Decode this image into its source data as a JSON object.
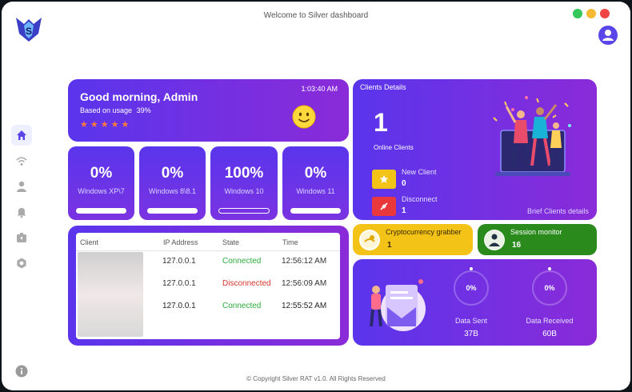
{
  "window": {
    "title": "Welcome to Silver dashboard",
    "traffic_colors": [
      "#34c759",
      "#f5b932",
      "#ef4444"
    ]
  },
  "greeting": {
    "title": "Good morning, Admin",
    "usage_label": "Based on usage",
    "usage_value": "39%",
    "rating": 5,
    "time": "1:03:40 AM"
  },
  "os_stats": [
    {
      "pct": "0%",
      "name": "Windows XP\\7"
    },
    {
      "pct": "0%",
      "name": "Windows 8\\8.1"
    },
    {
      "pct": "100%",
      "name": "Windows 10"
    },
    {
      "pct": "0%",
      "name": "Windows 11"
    }
  ],
  "clients_details": {
    "title": "Clients Details",
    "online_count": "1",
    "online_label": "Online Clients",
    "new_client_label": "New Client",
    "new_client_value": "0",
    "disconnect_label": "Disconnect",
    "disconnect_value": "1",
    "brief_link": "Brief Clients details"
  },
  "client_table": {
    "headers": [
      "Client",
      "IP Address",
      "State",
      "Time"
    ],
    "rows": [
      {
        "ip": "127.0.0.1",
        "state": "Connected",
        "time": "12:56:12 AM",
        "state_color": "#2eaa3c"
      },
      {
        "ip": "127.0.0.1",
        "state": "Disconnected",
        "time": "12:56:09 AM",
        "state_color": "#d9362b"
      },
      {
        "ip": "127.0.0.1",
        "state": "Connected",
        "time": "12:55:52 AM",
        "state_color": "#2eaa3c"
      }
    ]
  },
  "crypto": {
    "title": "Cryptocurrency grabber",
    "value": "1"
  },
  "session": {
    "title": "Session monitor",
    "value": "16"
  },
  "data_stats": {
    "sent": {
      "pct": "0%",
      "label": "Data Sent",
      "value": "37B"
    },
    "received": {
      "pct": "0%",
      "label": "Data Received",
      "value": "60B"
    }
  },
  "footer": "© Copyright Silver RAT v1.0. All Rights Reserved",
  "colors": {
    "purple": "#5a35ec",
    "violet": "#8a2bd8",
    "yellow": "#f3c318",
    "green": "#2a8a1c",
    "accent": "#5a45e8"
  }
}
